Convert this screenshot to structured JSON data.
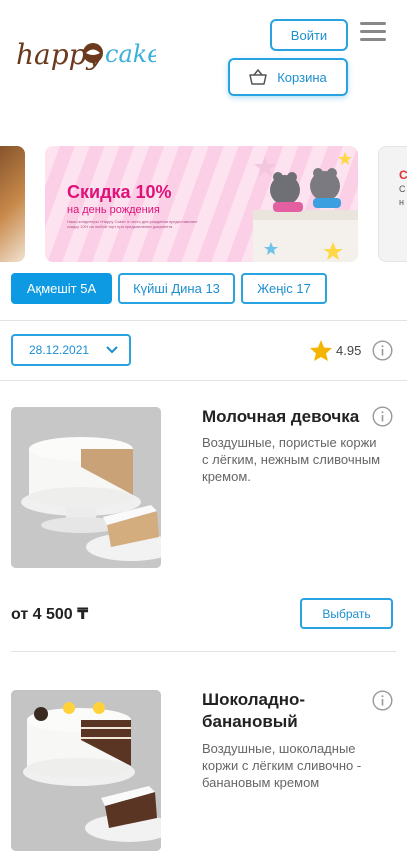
{
  "header": {
    "logo_text_left": "happy",
    "logo_text_right": "cake",
    "login_label": "Войти",
    "cart_label": "Корзина"
  },
  "banner": {
    "title": "Скидка 10%",
    "subtitle": "на день рождения",
    "fine_print": "Наши кондитеры «Happy Cake» в честь дня рождения предоставляют скидку 10% на любой торт при предъявлении документа"
  },
  "locations": [
    {
      "label": "Ақмешіт 5А",
      "active": true
    },
    {
      "label": "Күйші Дина 13",
      "active": false
    },
    {
      "label": "Жеңіс 17",
      "active": false
    }
  ],
  "filter": {
    "date": "28.12.2021",
    "rating": "4.95"
  },
  "products": [
    {
      "name": "Молочная девочка",
      "description": "Воздушные, пористые коржи с лёгким, нежным сливочным кремом.",
      "price": "от 4 500 ₸",
      "button": "Выбрать"
    },
    {
      "name": "Шоколадно-банановый",
      "description": "Воздушные, шоколадные коржи с лёгким сливочно - банановым кремом"
    }
  ],
  "colors": {
    "accent": "#29a3e0",
    "active_tab": "#0e9ae3",
    "promo": "#e0127a",
    "star": "#f5b400"
  }
}
